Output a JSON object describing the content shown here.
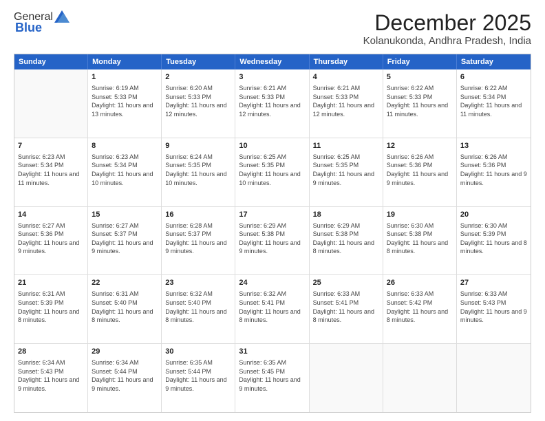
{
  "logo": {
    "general": "General",
    "blue": "Blue"
  },
  "title": "December 2025",
  "subtitle": "Kolanukonda, Andhra Pradesh, India",
  "header_days": [
    "Sunday",
    "Monday",
    "Tuesday",
    "Wednesday",
    "Thursday",
    "Friday",
    "Saturday"
  ],
  "weeks": [
    [
      {
        "day": "",
        "sunrise": "",
        "sunset": "",
        "daylight": ""
      },
      {
        "day": "1",
        "sunrise": "Sunrise: 6:19 AM",
        "sunset": "Sunset: 5:33 PM",
        "daylight": "Daylight: 11 hours and 13 minutes."
      },
      {
        "day": "2",
        "sunrise": "Sunrise: 6:20 AM",
        "sunset": "Sunset: 5:33 PM",
        "daylight": "Daylight: 11 hours and 12 minutes."
      },
      {
        "day": "3",
        "sunrise": "Sunrise: 6:21 AM",
        "sunset": "Sunset: 5:33 PM",
        "daylight": "Daylight: 11 hours and 12 minutes."
      },
      {
        "day": "4",
        "sunrise": "Sunrise: 6:21 AM",
        "sunset": "Sunset: 5:33 PM",
        "daylight": "Daylight: 11 hours and 12 minutes."
      },
      {
        "day": "5",
        "sunrise": "Sunrise: 6:22 AM",
        "sunset": "Sunset: 5:33 PM",
        "daylight": "Daylight: 11 hours and 11 minutes."
      },
      {
        "day": "6",
        "sunrise": "Sunrise: 6:22 AM",
        "sunset": "Sunset: 5:34 PM",
        "daylight": "Daylight: 11 hours and 11 minutes."
      }
    ],
    [
      {
        "day": "7",
        "sunrise": "Sunrise: 6:23 AM",
        "sunset": "Sunset: 5:34 PM",
        "daylight": "Daylight: 11 hours and 11 minutes."
      },
      {
        "day": "8",
        "sunrise": "Sunrise: 6:23 AM",
        "sunset": "Sunset: 5:34 PM",
        "daylight": "Daylight: 11 hours and 10 minutes."
      },
      {
        "day": "9",
        "sunrise": "Sunrise: 6:24 AM",
        "sunset": "Sunset: 5:35 PM",
        "daylight": "Daylight: 11 hours and 10 minutes."
      },
      {
        "day": "10",
        "sunrise": "Sunrise: 6:25 AM",
        "sunset": "Sunset: 5:35 PM",
        "daylight": "Daylight: 11 hours and 10 minutes."
      },
      {
        "day": "11",
        "sunrise": "Sunrise: 6:25 AM",
        "sunset": "Sunset: 5:35 PM",
        "daylight": "Daylight: 11 hours and 9 minutes."
      },
      {
        "day": "12",
        "sunrise": "Sunrise: 6:26 AM",
        "sunset": "Sunset: 5:36 PM",
        "daylight": "Daylight: 11 hours and 9 minutes."
      },
      {
        "day": "13",
        "sunrise": "Sunrise: 6:26 AM",
        "sunset": "Sunset: 5:36 PM",
        "daylight": "Daylight: 11 hours and 9 minutes."
      }
    ],
    [
      {
        "day": "14",
        "sunrise": "Sunrise: 6:27 AM",
        "sunset": "Sunset: 5:36 PM",
        "daylight": "Daylight: 11 hours and 9 minutes."
      },
      {
        "day": "15",
        "sunrise": "Sunrise: 6:27 AM",
        "sunset": "Sunset: 5:37 PM",
        "daylight": "Daylight: 11 hours and 9 minutes."
      },
      {
        "day": "16",
        "sunrise": "Sunrise: 6:28 AM",
        "sunset": "Sunset: 5:37 PM",
        "daylight": "Daylight: 11 hours and 9 minutes."
      },
      {
        "day": "17",
        "sunrise": "Sunrise: 6:29 AM",
        "sunset": "Sunset: 5:38 PM",
        "daylight": "Daylight: 11 hours and 9 minutes."
      },
      {
        "day": "18",
        "sunrise": "Sunrise: 6:29 AM",
        "sunset": "Sunset: 5:38 PM",
        "daylight": "Daylight: 11 hours and 8 minutes."
      },
      {
        "day": "19",
        "sunrise": "Sunrise: 6:30 AM",
        "sunset": "Sunset: 5:38 PM",
        "daylight": "Daylight: 11 hours and 8 minutes."
      },
      {
        "day": "20",
        "sunrise": "Sunrise: 6:30 AM",
        "sunset": "Sunset: 5:39 PM",
        "daylight": "Daylight: 11 hours and 8 minutes."
      }
    ],
    [
      {
        "day": "21",
        "sunrise": "Sunrise: 6:31 AM",
        "sunset": "Sunset: 5:39 PM",
        "daylight": "Daylight: 11 hours and 8 minutes."
      },
      {
        "day": "22",
        "sunrise": "Sunrise: 6:31 AM",
        "sunset": "Sunset: 5:40 PM",
        "daylight": "Daylight: 11 hours and 8 minutes."
      },
      {
        "day": "23",
        "sunrise": "Sunrise: 6:32 AM",
        "sunset": "Sunset: 5:40 PM",
        "daylight": "Daylight: 11 hours and 8 minutes."
      },
      {
        "day": "24",
        "sunrise": "Sunrise: 6:32 AM",
        "sunset": "Sunset: 5:41 PM",
        "daylight": "Daylight: 11 hours and 8 minutes."
      },
      {
        "day": "25",
        "sunrise": "Sunrise: 6:33 AM",
        "sunset": "Sunset: 5:41 PM",
        "daylight": "Daylight: 11 hours and 8 minutes."
      },
      {
        "day": "26",
        "sunrise": "Sunrise: 6:33 AM",
        "sunset": "Sunset: 5:42 PM",
        "daylight": "Daylight: 11 hours and 8 minutes."
      },
      {
        "day": "27",
        "sunrise": "Sunrise: 6:33 AM",
        "sunset": "Sunset: 5:43 PM",
        "daylight": "Daylight: 11 hours and 9 minutes."
      }
    ],
    [
      {
        "day": "28",
        "sunrise": "Sunrise: 6:34 AM",
        "sunset": "Sunset: 5:43 PM",
        "daylight": "Daylight: 11 hours and 9 minutes."
      },
      {
        "day": "29",
        "sunrise": "Sunrise: 6:34 AM",
        "sunset": "Sunset: 5:44 PM",
        "daylight": "Daylight: 11 hours and 9 minutes."
      },
      {
        "day": "30",
        "sunrise": "Sunrise: 6:35 AM",
        "sunset": "Sunset: 5:44 PM",
        "daylight": "Daylight: 11 hours and 9 minutes."
      },
      {
        "day": "31",
        "sunrise": "Sunrise: 6:35 AM",
        "sunset": "Sunset: 5:45 PM",
        "daylight": "Daylight: 11 hours and 9 minutes."
      },
      {
        "day": "",
        "sunrise": "",
        "sunset": "",
        "daylight": ""
      },
      {
        "day": "",
        "sunrise": "",
        "sunset": "",
        "daylight": ""
      },
      {
        "day": "",
        "sunrise": "",
        "sunset": "",
        "daylight": ""
      }
    ]
  ]
}
